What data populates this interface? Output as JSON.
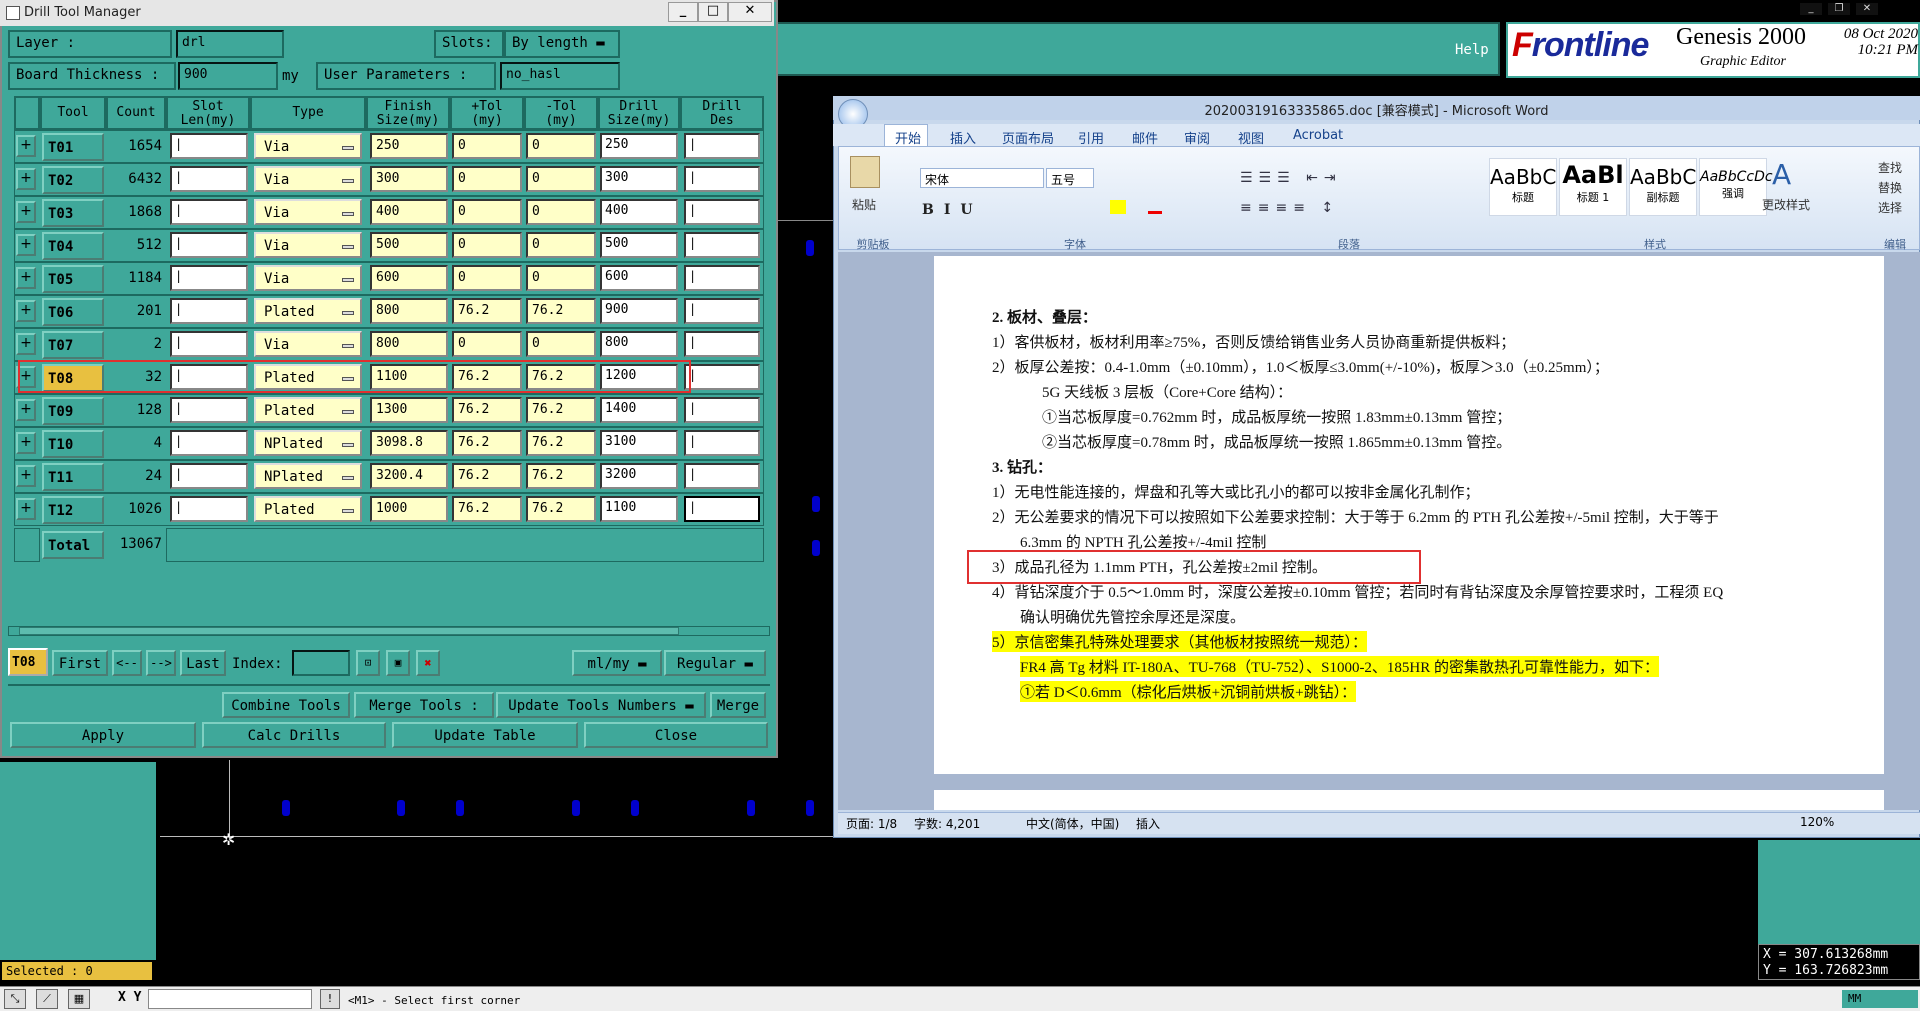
{
  "genesis": {
    "help": "Help",
    "brand_f": "F",
    "brand_rest": "rontline",
    "product": "Genesis 2000",
    "subtitle": "Graphic Editor",
    "date": "08 Oct 2020",
    "time": "10:21 PM",
    "selected": "Selected : 0",
    "xy_label": "X Y :",
    "coord_x": "X = 307.613268mm",
    "coord_y": "Y = 163.726823mm",
    "prompt": "<M1> - Select first corner",
    "units": "MM"
  },
  "dtm": {
    "title": "Drill Tool Manager",
    "layer_label": "Layer          :",
    "layer_value": "drl",
    "slots_label": "Slots:",
    "slots_value": "By length",
    "board_thickness_label": "Board Thickness :",
    "board_thickness_value": "900",
    "board_thickness_unit": "my",
    "user_params_label": "User Parameters :",
    "user_params_value": "no_hasl",
    "headers": {
      "tool": "Tool",
      "count": "Count",
      "slot": "Slot\nLen(my)",
      "type": "Type",
      "finish": "Finish\nSize(my)",
      "ptol": "+Tol\n(my)",
      "mtol": "-Tol\n(my)",
      "drill": "Drill\nSize(my)",
      "des": "Drill\nDes"
    },
    "rows": [
      {
        "tool": "T01",
        "count": "1654",
        "type": "Via",
        "finish": "250",
        "ptol": "0",
        "mtol": "0",
        "drill": "250"
      },
      {
        "tool": "T02",
        "count": "6432",
        "type": "Via",
        "finish": "300",
        "ptol": "0",
        "mtol": "0",
        "drill": "300"
      },
      {
        "tool": "T03",
        "count": "1868",
        "type": "Via",
        "finish": "400",
        "ptol": "0",
        "mtol": "0",
        "drill": "400"
      },
      {
        "tool": "T04",
        "count": "512",
        "type": "Via",
        "finish": "500",
        "ptol": "0",
        "mtol": "0",
        "drill": "500"
      },
      {
        "tool": "T05",
        "count": "1184",
        "type": "Via",
        "finish": "600",
        "ptol": "0",
        "mtol": "0",
        "drill": "600"
      },
      {
        "tool": "T06",
        "count": "201",
        "type": "Plated",
        "finish": "800",
        "ptol": "76.2",
        "mtol": "76.2",
        "drill": "900"
      },
      {
        "tool": "T07",
        "count": "2",
        "type": "Via",
        "finish": "800",
        "ptol": "0",
        "mtol": "0",
        "drill": "800"
      },
      {
        "tool": "T08",
        "count": "32",
        "type": "Plated",
        "finish": "1100",
        "ptol": "76.2",
        "mtol": "76.2",
        "drill": "1200"
      },
      {
        "tool": "T09",
        "count": "128",
        "type": "Plated",
        "finish": "1300",
        "ptol": "76.2",
        "mtol": "76.2",
        "drill": "1400"
      },
      {
        "tool": "T10",
        "count": "4",
        "type": "NPlated",
        "finish": "3098.8",
        "ptol": "76.2",
        "mtol": "76.2",
        "drill": "3100"
      },
      {
        "tool": "T11",
        "count": "24",
        "type": "NPlated",
        "finish": "3200.4",
        "ptol": "76.2",
        "mtol": "76.2",
        "drill": "3200"
      },
      {
        "tool": "T12",
        "count": "1026",
        "type": "Plated",
        "finish": "1000",
        "ptol": "76.2",
        "mtol": "76.2",
        "drill": "1100"
      }
    ],
    "total_label": "Total",
    "total_value": "13067",
    "current_tool": "T08",
    "nav": {
      "first": "First",
      "prev": "<--",
      "next": "-->",
      "last": "Last",
      "index": "Index:"
    },
    "unit_mode": "ml/my",
    "regular": "Regular",
    "combine": "Combine Tools",
    "merge_label": "Merge Tools :",
    "update_numbers": "Update Tools Numbers",
    "merge": "Merge",
    "apply": "Apply",
    "calc": "Calc Drills",
    "update_table": "Update Table",
    "close": "Close"
  },
  "word": {
    "title": "20200319163335865.doc [兼容模式] - Microsoft Word",
    "tabs": [
      "开始",
      "插入",
      "页面布局",
      "引用",
      "邮件",
      "审阅",
      "视图",
      "Acrobat"
    ],
    "font_name": "宋体",
    "font_size": "五号",
    "paste": "粘贴",
    "groups": {
      "clipboard": "剪贴板",
      "font": "字体",
      "paragraph": "段落",
      "styles": "样式",
      "editing": "编辑"
    },
    "styles": [
      {
        "sample": "AaBbC",
        "name": "标题"
      },
      {
        "sample": "AaBl",
        "name": "标题 1"
      },
      {
        "sample": "AaBbC",
        "name": "副标题"
      },
      {
        "sample": "AaBbCcDc",
        "name": "强调"
      }
    ],
    "change_styles": "更改样式",
    "find": "查找",
    "replace": "替换",
    "select": "选择",
    "doc_lines": [
      "2.   板材、叠层：",
      "1）客供板材，板材利用率≥75%，否则反馈给销售业务人员协商重新提供板料；",
      "2）板厚公差按：0.4-1.0mm（±0.10mm），1.0＜板厚≤3.0mm(+/-10%)，板厚＞3.0（±0.25mm）；",
      "5G 天线板 3 层板（Core+Core 结构）：",
      "①当芯板厚度=0.762mm 时，成品板厚统一按照 1.83mm±0.13mm 管控；",
      "②当芯板厚度=0.78mm 时，成品板厚统一按照 1.865mm±0.13mm 管控。",
      "3.   钻孔：",
      "1）无电性能连接的，焊盘和孔等大或比孔小的都可以按非金属化孔制作；",
      "2）无公差要求的情况下可以按照如下公差要求控制：大于等于 6.2mm 的 PTH 孔公差按+/-5mil 控制，大于等于",
      "6.3mm 的 NPTH 孔公差按+/-4mil 控制",
      "3）成品孔径为 1.1mm PTH，孔公差按±2mil 控制。",
      "4）背钻深度介于 0.5～1.0mm 时，深度公差按±0.10mm 管控；若同时有背钻深度及余厚管控要求时，工程须 EQ",
      "确认明确优先管控余厚还是深度。",
      "5）京信密集孔特殊处理要求（其他板材按照统一规范）：",
      "FR4 高 Tg 材料 IT-180A、TU-768（TU-752）、S1000-2、185HR 的密集散热孔可靠性能力，如下：",
      "①若 D＜0.6mm（棕化后烘板+沉铜前烘板+跳钻）："
    ],
    "status": {
      "page": "页面: 1/8",
      "words": "字数: 4,201",
      "lang": "中文(简体，中国)",
      "mode": "插入",
      "zoom": "120%"
    }
  }
}
